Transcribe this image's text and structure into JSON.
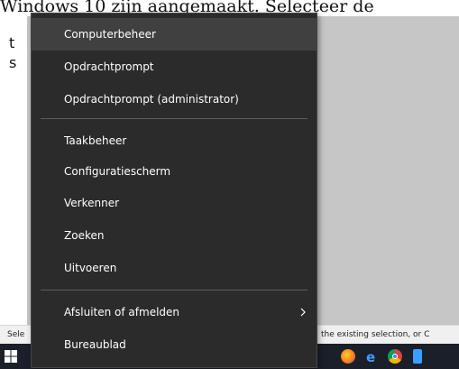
{
  "document": {
    "left_text": "Windows 10 zijn aangemaakt. Selecteer de",
    "frag_t": "t",
    "frag_s": "s"
  },
  "status_bar": {
    "left": "Sele",
    "right": "the existing selection, or C"
  },
  "menu": {
    "items": [
      {
        "label": "Computerbeheer"
      },
      {
        "label": "Opdrachtprompt"
      },
      {
        "label": "Opdrachtprompt (administrator)"
      },
      {
        "label": "Taakbeheer"
      },
      {
        "label": "Configuratiescherm"
      },
      {
        "label": "Verkenner"
      },
      {
        "label": "Zoeken"
      },
      {
        "label": "Uitvoeren"
      },
      {
        "label": "Afsluiten of afmelden"
      },
      {
        "label": "Bureaublad"
      }
    ]
  },
  "colors": {
    "menu_bg": "#2b2b2b",
    "menu_highlight": "#404040",
    "separator": "#5e5e5e",
    "taskbar": "#1a1f2a"
  },
  "taskbar": {
    "icons": [
      "start-icon",
      "firefox-icon",
      "edge-icon",
      "chrome-icon",
      "store-icon"
    ]
  }
}
